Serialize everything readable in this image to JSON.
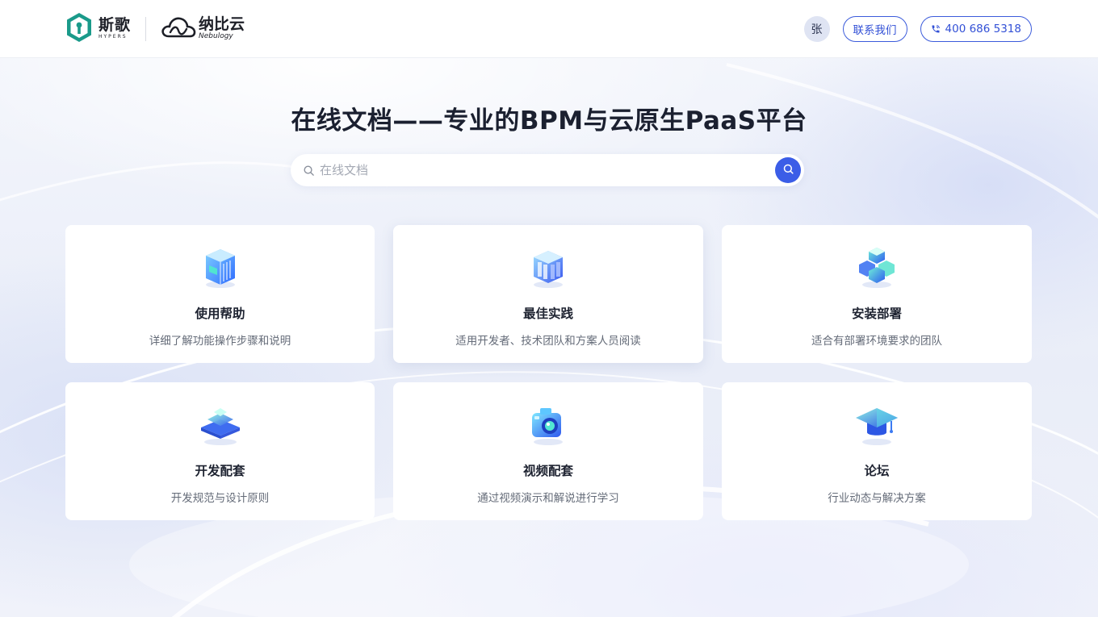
{
  "header": {
    "brand_hyper": {
      "cn": "斯歌",
      "en": "HYPERS"
    },
    "brand_nebu": {
      "cn": "纳比云",
      "en": "Nebulogy"
    },
    "avatar_text": "张",
    "contact_label": "联系我们",
    "phone_label": "400 686 5318"
  },
  "hero": {
    "title": "在线文档——专业的BPM与云原生PaaS平台",
    "search_placeholder": "在线文档"
  },
  "cards": [
    {
      "title": "使用帮助",
      "desc": "详细了解功能操作步骤和说明",
      "icon": "book-stack-icon"
    },
    {
      "title": "最佳实践",
      "desc": "适用开发者、技术团队和方案人员阅读",
      "icon": "library-icon"
    },
    {
      "title": "安装部署",
      "desc": "适合有部署环境要求的团队",
      "icon": "cubes-icon"
    },
    {
      "title": "开发配套",
      "desc": "开发规范与设计原则",
      "icon": "layers-icon"
    },
    {
      "title": "视频配套",
      "desc": "通过视频演示和解说进行学习",
      "icon": "camera-icon"
    },
    {
      "title": "论坛",
      "desc": "行业动态与解决方案",
      "icon": "graduation-cap-icon"
    }
  ],
  "colors": {
    "accent": "#3b5de7",
    "brand_teal": "#1a9a8a"
  }
}
